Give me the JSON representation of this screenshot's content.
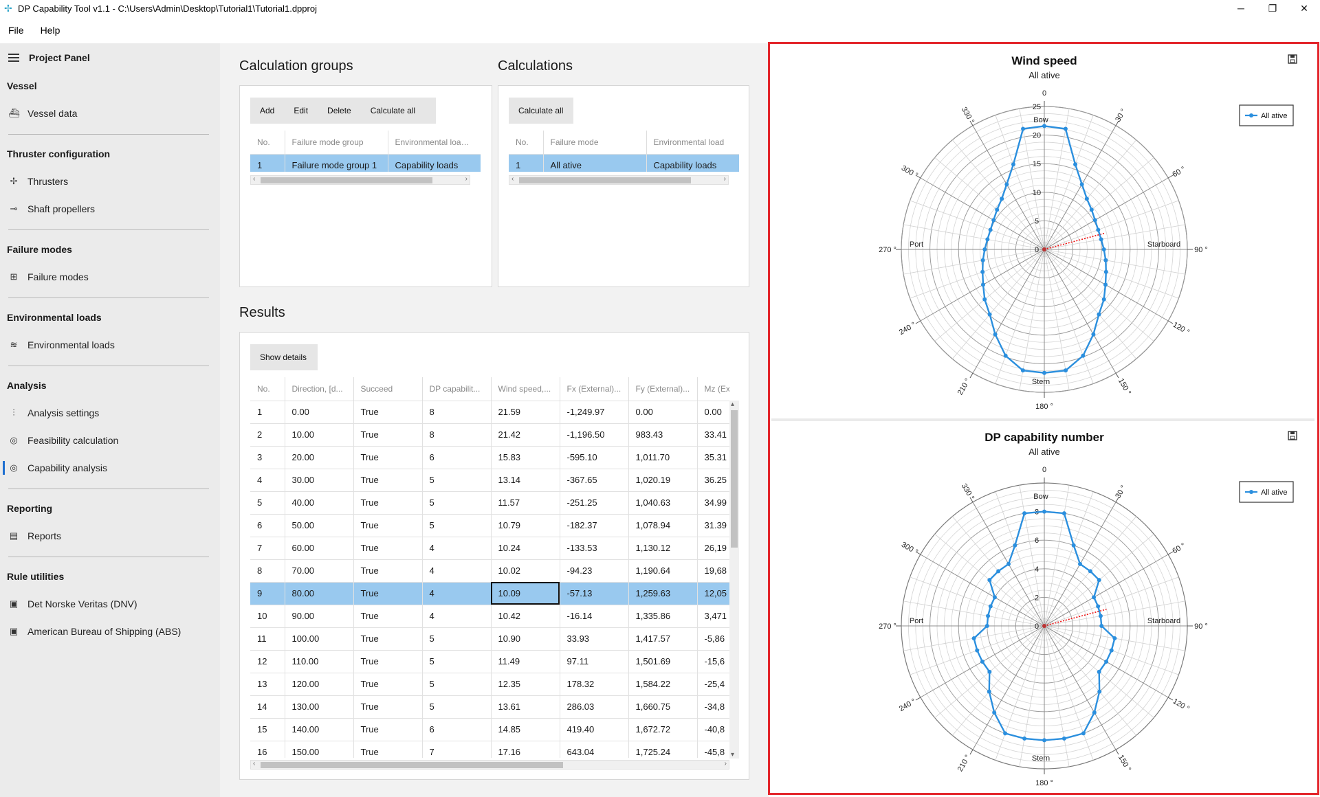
{
  "window": {
    "title": "DP Capability Tool v1.1 - C:\\Users\\Admin\\Desktop\\Tutorial1\\Tutorial1.dpproj",
    "minimize": "─",
    "restore": "❐",
    "close": "✕"
  },
  "menu": [
    "File",
    "Help"
  ],
  "sidebar": {
    "header": "Project Panel",
    "sections": [
      {
        "title": "Vessel",
        "items": [
          {
            "label": "Vessel data",
            "icon": "ship-icon",
            "glyph": "⛴"
          }
        ]
      },
      {
        "title": "Thruster configuration",
        "items": [
          {
            "label": "Thrusters",
            "icon": "thruster-icon",
            "glyph": "✢"
          },
          {
            "label": "Shaft propellers",
            "icon": "propeller-icon",
            "glyph": "⊸"
          }
        ]
      },
      {
        "title": "Failure modes",
        "items": [
          {
            "label": "Failure modes",
            "icon": "failure-modes-icon",
            "glyph": "⊞"
          }
        ]
      },
      {
        "title": "Environmental loads",
        "items": [
          {
            "label": "Environmental loads",
            "icon": "waves-icon",
            "glyph": "≋"
          }
        ]
      },
      {
        "title": "Analysis",
        "items": [
          {
            "label": "Analysis settings",
            "icon": "sliders-icon",
            "glyph": "⫶"
          },
          {
            "label": "Feasibility calculation",
            "icon": "target-icon",
            "glyph": "◎"
          },
          {
            "label": "Capability analysis",
            "icon": "target-icon",
            "glyph": "◎",
            "active": true
          }
        ]
      },
      {
        "title": "Reporting",
        "items": [
          {
            "label": "Reports",
            "icon": "report-icon",
            "glyph": "▤"
          }
        ]
      },
      {
        "title": "Rule utilities",
        "items": [
          {
            "label": "Det Norske Veritas (DNV)",
            "icon": "book-icon",
            "glyph": "▣"
          },
          {
            "label": "American Bureau of Shipping (ABS)",
            "icon": "book-icon",
            "glyph": "▣"
          }
        ]
      }
    ]
  },
  "calc_groups": {
    "heading": "Calculation groups",
    "buttons": [
      "Add",
      "Edit",
      "Delete",
      "Calculate all"
    ],
    "columns": [
      "No.",
      "Failure mode group",
      "Environmental load g..."
    ],
    "rows": [
      [
        "1",
        "Failure mode group 1",
        "Capability loads"
      ]
    ]
  },
  "calculations": {
    "heading": "Calculations",
    "buttons": [
      "Calculate all"
    ],
    "columns": [
      "No.",
      "Failure mode",
      "Environmental load"
    ],
    "rows": [
      [
        "1",
        "All ative",
        "Capability loads"
      ]
    ]
  },
  "results": {
    "heading": "Results",
    "button": "Show details",
    "columns": [
      "No.",
      "Direction, [d...",
      "Succeed",
      "DP capabilit...",
      "Wind speed,...",
      "Fx (External)...",
      "Fy (External)...",
      "Mz (Exter"
    ],
    "rows": [
      [
        "1",
        "0.00",
        "True",
        "8",
        "21.59",
        "-1,249.97",
        "0.00",
        "0.00"
      ],
      [
        "2",
        "10.00",
        "True",
        "8",
        "21.42",
        "-1,196.50",
        "983.43",
        "33.41"
      ],
      [
        "3",
        "20.00",
        "True",
        "6",
        "15.83",
        "-595.10",
        "1,011.70",
        "35.31"
      ],
      [
        "4",
        "30.00",
        "True",
        "5",
        "13.14",
        "-367.65",
        "1,020.19",
        "36.25"
      ],
      [
        "5",
        "40.00",
        "True",
        "5",
        "11.57",
        "-251.25",
        "1,040.63",
        "34.99"
      ],
      [
        "6",
        "50.00",
        "True",
        "5",
        "10.79",
        "-182.37",
        "1,078.94",
        "31.39"
      ],
      [
        "7",
        "60.00",
        "True",
        "4",
        "10.24",
        "-133.53",
        "1,130.12",
        "26,19"
      ],
      [
        "8",
        "70.00",
        "True",
        "4",
        "10.02",
        "-94.23",
        "1,190.64",
        "19,68"
      ],
      [
        "9",
        "80.00",
        "True",
        "4",
        "10.09",
        "-57.13",
        "1,259.63",
        "12,05"
      ],
      [
        "10",
        "90.00",
        "True",
        "4",
        "10.42",
        "-16.14",
        "1,335.86",
        "3,471"
      ],
      [
        "11",
        "100.00",
        "True",
        "5",
        "10.90",
        "33.93",
        "1,417.57",
        "-5,86"
      ],
      [
        "12",
        "110.00",
        "True",
        "5",
        "11.49",
        "97.11",
        "1,501.69",
        "-15,6"
      ],
      [
        "13",
        "120.00",
        "True",
        "5",
        "12.35",
        "178.32",
        "1,584.22",
        "-25,4"
      ],
      [
        "14",
        "130.00",
        "True",
        "5",
        "13.61",
        "286.03",
        "1,660.75",
        "-34,8"
      ],
      [
        "15",
        "140.00",
        "True",
        "6",
        "14.85",
        "419.40",
        "1,672.72",
        "-40,8"
      ],
      [
        "16",
        "150.00",
        "True",
        "7",
        "17.16",
        "643.04",
        "1,725.24",
        "-45,8"
      ]
    ],
    "selected_row": 8
  },
  "chart_data": [
    {
      "type": "polar-line",
      "title": "Wind speed",
      "subtitle": "All ative",
      "legend": "All ative",
      "legend_position": "top-right",
      "rmax": 25,
      "rticks": [
        0,
        5,
        10,
        15,
        20,
        25
      ],
      "angle_labels": [
        "0",
        "30 °",
        "60 °",
        "90 °",
        "120 °",
        "150 °",
        "180 °",
        "210 °",
        "240 °",
        "270 °",
        "300 °",
        "330 °"
      ],
      "direction_labels": {
        "bow": "Bow",
        "starboard": "Starboard",
        "stern": "Stern",
        "port": "Port"
      },
      "current_direction": 75,
      "current_marker_r": 11,
      "directions": [
        0,
        10,
        20,
        30,
        40,
        50,
        60,
        70,
        80,
        90,
        100,
        110,
        120,
        130,
        140,
        150,
        160,
        170,
        180,
        190,
        200,
        210,
        220,
        230,
        240,
        250,
        260,
        270,
        280,
        290,
        300,
        310,
        320,
        330,
        340,
        350
      ],
      "values": [
        21.59,
        21.42,
        15.83,
        13.14,
        11.57,
        10.79,
        10.24,
        10.02,
        10.09,
        10.42,
        10.9,
        11.49,
        12.35,
        13.61,
        14.85,
        17.16,
        19.8,
        21.5,
        21.6,
        21.5,
        19.8,
        17.16,
        14.85,
        13.61,
        12.35,
        11.49,
        10.9,
        10.42,
        10.09,
        10.02,
        10.24,
        10.79,
        11.57,
        13.14,
        15.83,
        21.42
      ],
      "color": "#2b8fde"
    },
    {
      "type": "polar-line",
      "title": "DP capability number",
      "subtitle": "All ative",
      "legend": "All ative",
      "legend_position": "top-right",
      "rmax": 10,
      "rticks": [
        0,
        2,
        4,
        6,
        8
      ],
      "angle_labels": [
        "0",
        "30 °",
        "60 °",
        "90 °",
        "120 °",
        "150 °",
        "180 °",
        "210 °",
        "240 °",
        "270 °",
        "300 °",
        "330 °"
      ],
      "direction_labels": {
        "bow": "Bow",
        "starboard": "Starboard",
        "stern": "Stern",
        "port": "Port"
      },
      "current_direction": 75,
      "current_marker_r": 4.5,
      "directions": [
        0,
        10,
        20,
        30,
        40,
        50,
        60,
        70,
        80,
        90,
        100,
        110,
        120,
        130,
        140,
        150,
        160,
        170,
        180,
        190,
        200,
        210,
        220,
        230,
        240,
        250,
        260,
        270,
        280,
        290,
        300,
        310,
        320,
        330,
        340,
        350
      ],
      "values": [
        8,
        8,
        6,
        5,
        5,
        5,
        4,
        4,
        4,
        4,
        5,
        5,
        5,
        5,
        6,
        7,
        8,
        8,
        8,
        8,
        8,
        7,
        6,
        5,
        5,
        5,
        5,
        4,
        4,
        4,
        4,
        5,
        5,
        5,
        6,
        8
      ],
      "color": "#2b8fde"
    }
  ],
  "colors": {
    "accent": "#1e6fd0",
    "selection": "#99c9ef",
    "series": "#2b8fde",
    "highlight": "#e3262c"
  }
}
